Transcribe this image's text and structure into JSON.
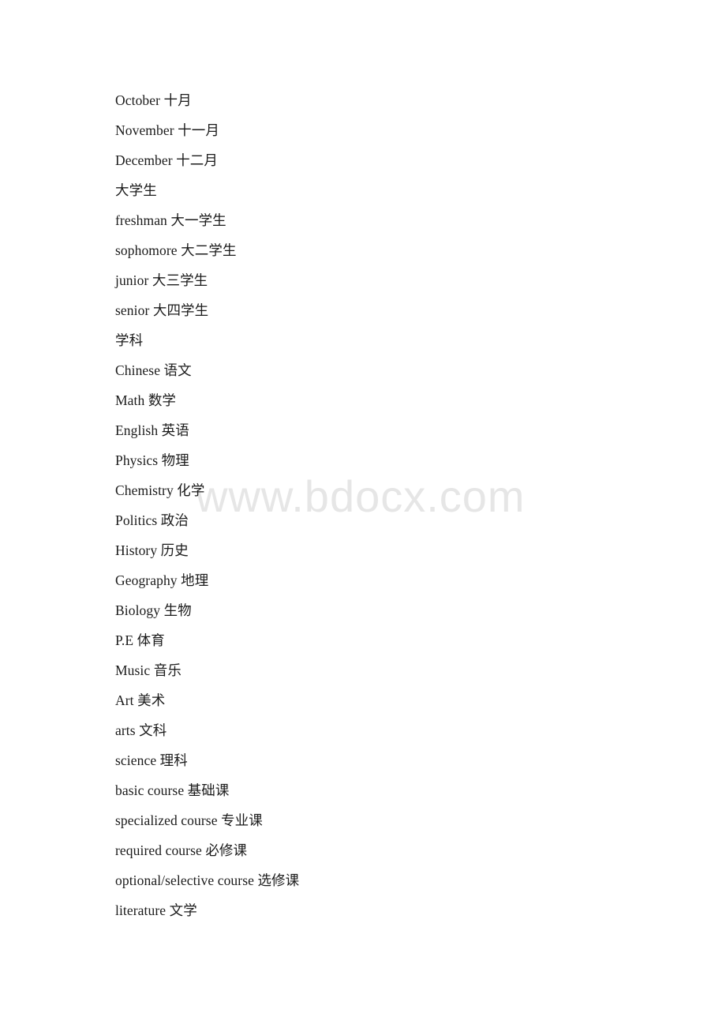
{
  "document": {
    "watermark": "www.bdocx.com",
    "lines": [
      {
        "text": "October 十月"
      },
      {
        "text": "November 十一月"
      },
      {
        "text": "December 十二月"
      },
      {
        "text": "大学生"
      },
      {
        "text": "freshman 大一学生"
      },
      {
        "text": "sophomore 大二学生"
      },
      {
        "text": "junior 大三学生"
      },
      {
        "text": "senior 大四学生"
      },
      {
        "text": "学科"
      },
      {
        "text": "Chinese 语文"
      },
      {
        "text": "Math 数学"
      },
      {
        "text": "English 英语"
      },
      {
        "text": "Physics 物理"
      },
      {
        "text": "Chemistry 化学"
      },
      {
        "text": "Politics 政治"
      },
      {
        "text": "History 历史"
      },
      {
        "text": "Geography 地理"
      },
      {
        "text": "Biology 生物"
      },
      {
        "text": "P.E 体育"
      },
      {
        "text": "Music 音乐"
      },
      {
        "text": "Art 美术"
      },
      {
        "text": "arts 文科"
      },
      {
        "text": "science 理科"
      },
      {
        "text": "basic course 基础课"
      },
      {
        "text": "specialized course 专业课"
      },
      {
        "text": "required course 必修课"
      },
      {
        "text": "optional/selective course 选修课"
      },
      {
        "text": "literature 文学"
      }
    ]
  }
}
